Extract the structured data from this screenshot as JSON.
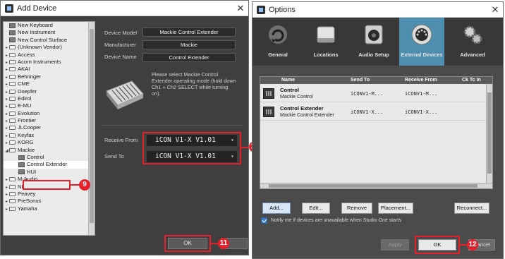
{
  "add_device": {
    "title": "Add Device",
    "tree": [
      {
        "label": "New Keyboard",
        "icon": "keyboard-icon",
        "expander": "",
        "indent": 0
      },
      {
        "label": "New Instrument",
        "icon": "instrument-icon",
        "expander": "",
        "indent": 0
      },
      {
        "label": "New Control Surface",
        "icon": "control-surface-icon",
        "expander": "",
        "indent": 0
      },
      {
        "label": "(Unknown Vendor)",
        "icon": "folder-icon",
        "expander": "▸",
        "indent": 0
      },
      {
        "label": "Access",
        "icon": "folder-icon",
        "expander": "▸",
        "indent": 0
      },
      {
        "label": "Acorn Instruments",
        "icon": "folder-icon",
        "expander": "▸",
        "indent": 0
      },
      {
        "label": "AKAI",
        "icon": "folder-icon",
        "expander": "▸",
        "indent": 0
      },
      {
        "label": "Behringer",
        "icon": "folder-icon",
        "expander": "▸",
        "indent": 0
      },
      {
        "label": "CME",
        "icon": "folder-icon",
        "expander": "▸",
        "indent": 0
      },
      {
        "label": "Doepfer",
        "icon": "folder-icon",
        "expander": "▸",
        "indent": 0
      },
      {
        "label": "Edirol",
        "icon": "folder-icon",
        "expander": "▸",
        "indent": 0
      },
      {
        "label": "E-MU",
        "icon": "folder-icon",
        "expander": "▸",
        "indent": 0
      },
      {
        "label": "Evolution",
        "icon": "folder-icon",
        "expander": "▸",
        "indent": 0
      },
      {
        "label": "Frontier",
        "icon": "folder-icon",
        "expander": "▸",
        "indent": 0
      },
      {
        "label": "JLCooper",
        "icon": "folder-icon",
        "expander": "▸",
        "indent": 0
      },
      {
        "label": "Keyfax",
        "icon": "folder-icon",
        "expander": "▸",
        "indent": 0
      },
      {
        "label": "KORG",
        "icon": "folder-icon",
        "expander": "▸",
        "indent": 0
      },
      {
        "label": "Mackie",
        "icon": "folder-open-icon",
        "expander": "◢",
        "indent": 0
      },
      {
        "label": "Control",
        "icon": "device-icon",
        "expander": "",
        "indent": 1
      },
      {
        "label": "Control Extender",
        "icon": "device-icon",
        "expander": "",
        "indent": 1,
        "selected": true
      },
      {
        "label": "HUI",
        "icon": "device-icon",
        "expander": "",
        "indent": 1
      },
      {
        "label": "M-Audio",
        "icon": "folder-icon",
        "expander": "▸",
        "indent": 0
      },
      {
        "label": "NI",
        "icon": "folder-icon",
        "expander": "▸",
        "indent": 0
      },
      {
        "label": "Peavey",
        "icon": "folder-icon",
        "expander": "▸",
        "indent": 0
      },
      {
        "label": "PreSonus",
        "icon": "folder-icon",
        "expander": "▸",
        "indent": 0
      },
      {
        "label": "Yamaha",
        "icon": "folder-icon",
        "expander": "▸",
        "indent": 0
      }
    ],
    "fields": {
      "device_model_label": "Device Model",
      "device_model_value": "Mackie Control Extender",
      "manufacturer_label": "Manufacturer",
      "manufacturer_value": "Mackie",
      "device_name_label": "Device Name",
      "device_name_value": "Control Extender"
    },
    "hint": "Please select Mackie Control Extender operating mode (hold down Ch1 + Ch2 SELECT while turning on).",
    "receive_from_label": "Receive From",
    "receive_from_value": "iCON V1-X V1.01",
    "send_to_label": "Send To",
    "send_to_value": "iCON V1-X V1.01",
    "ok_label": "OK",
    "callouts": {
      "tree": "9",
      "ports": "10",
      "ok": "11"
    }
  },
  "options": {
    "title": "Options",
    "tabs": [
      {
        "label": "General",
        "icon": "general-icon"
      },
      {
        "label": "Locations",
        "icon": "locations-icon"
      },
      {
        "label": "Audio Setup",
        "icon": "audio-setup-icon"
      },
      {
        "label": "External Devices",
        "icon": "external-devices-icon",
        "active": true
      },
      {
        "label": "Advanced",
        "icon": "advanced-icon"
      }
    ],
    "table": {
      "columns": [
        "Name",
        "Send To",
        "Receive From",
        "Ck Tc In"
      ],
      "rows": [
        {
          "name": "Control",
          "model": "Mackie Control",
          "send_to": "iCONV1-M...",
          "receive_from": "iCONV1-M..."
        },
        {
          "name": "Control Extender",
          "model": "Mackie Control Extender",
          "send_to": "iCONV1-X...",
          "receive_from": "iCONV1-X..."
        }
      ]
    },
    "buttons": {
      "add": "Add...",
      "edit": "Edit...",
      "remove": "Remove",
      "placement": "Placement...",
      "reconnect": "Reconnect..."
    },
    "notify_label": "Notify me if devices are unavailable when Studio One starts",
    "apply_label": "Apply",
    "ok_label": "OK",
    "cancel_label": "Cancel",
    "callout": "12"
  },
  "colors": {
    "accent": "#4e8fb0",
    "callout": "#e5202a"
  }
}
